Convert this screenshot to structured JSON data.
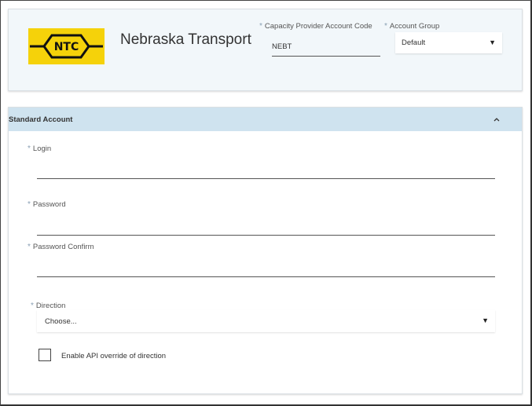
{
  "header": {
    "logo_text": "NTC",
    "company_name": "Nebraska Transport",
    "capacity_provider": {
      "label": "Capacity Provider Account Code",
      "value": "NEBT",
      "required_mark": "*"
    },
    "account_group": {
      "label": "Account Group",
      "value": "Default",
      "required_mark": "*"
    }
  },
  "standard_account": {
    "title": "Standard Account",
    "fields": {
      "login": {
        "label": "Login",
        "value": "",
        "required_mark": "*"
      },
      "password": {
        "label": "Password",
        "value": "",
        "required_mark": "*"
      },
      "password_confirm": {
        "label": "Password Confirm",
        "value": "",
        "required_mark": "*"
      },
      "direction": {
        "label": "Direction",
        "placeholder": "Choose...",
        "required_mark": "*"
      }
    },
    "api_override": {
      "label": "Enable API override of direction",
      "checked": false
    }
  },
  "icons": {
    "dropdown": "chevron-down-icon",
    "collapse": "chevron-up-icon"
  },
  "colors": {
    "header_bg": "#f2f7fa",
    "section_header_bg": "#cfe3ef",
    "logo_yellow": "#f5d20a",
    "required_mark": "#8aa0b4"
  }
}
